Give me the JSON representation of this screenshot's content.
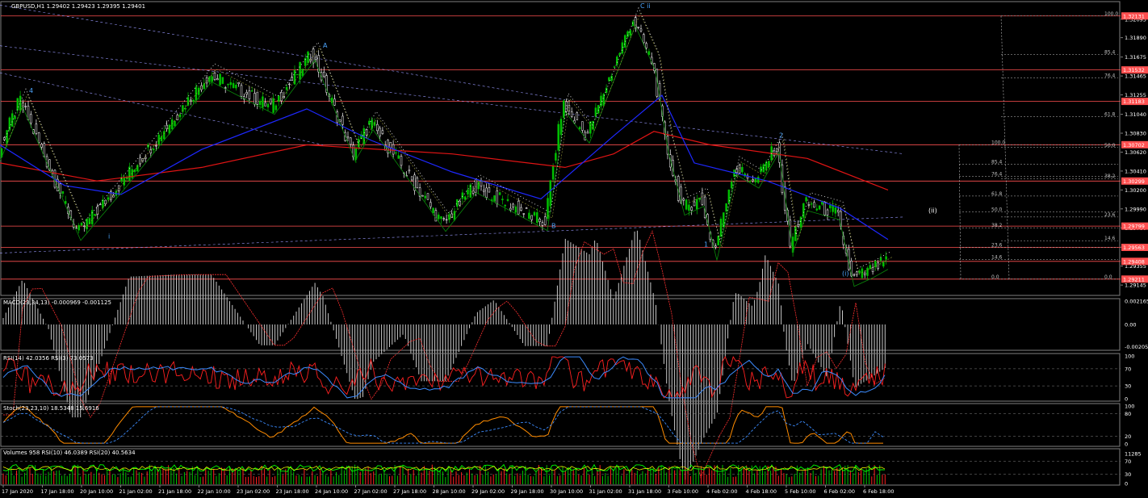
{
  "header": {
    "symbol_title": "GBPUSD,H1  1.29402 1.29423 1.29395 1.29401"
  },
  "colors": {
    "background": "#000000",
    "grid": "#808080",
    "bull": "#00c000",
    "bear": "#ffffff",
    "hline": "#ff5050",
    "ma_long": "#e01414",
    "ma_mid": "#1e28ff",
    "price_badge": "#ff5050",
    "macd_hist": "#c8c8c8",
    "macd_signal": "#ff3030",
    "rsi_slow": "#3c8cff",
    "rsi_fast": "#ff2020",
    "stoch_main": "#ff8c00",
    "stoch_signal": "#3c8cff",
    "vol_bar": "#00c000",
    "vol_rsi10": "#00ff00",
    "vol_rsi20": "#ffff00",
    "wave_label": "#4da6ff",
    "fib": "#c0c0c0"
  },
  "chart_data": [
    {
      "type": "candlestick",
      "title": "GBPUSD,H1",
      "ohlc_last": {
        "open": 1.29402,
        "high": 1.29423,
        "low": 1.29395,
        "close": 1.29401
      },
      "ylim": [
        1.2903,
        1.3229
      ],
      "y_ticks": [
        "1.32095",
        "1.31890",
        "1.31675",
        "1.31465",
        "1.31255",
        "1.31040",
        "1.30830",
        "1.30620",
        "1.30410",
        "1.30200",
        "1.29990",
        "1.29780",
        "1.29565",
        "1.29355",
        "1.29145"
      ],
      "x_ticks": [
        "17 Jan 2020",
        "17 Jan 18:00",
        "20 Jan 10:00",
        "21 Jan 02:00",
        "21 Jan 18:00",
        "22 Jan 10:00",
        "23 Jan 02:00",
        "23 Jan 18:00",
        "24 Jan 10:00",
        "27 Jan 02:00",
        "27 Jan 18:00",
        "28 Jan 10:00",
        "29 Jan 02:00",
        "29 Jan 18:00",
        "30 Jan 10:00",
        "31 Jan 02:00",
        "31 Jan 18:00",
        "3 Feb 10:00",
        "4 Feb 02:00",
        "4 Feb 18:00",
        "5 Feb 10:00",
        "6 Feb 02:00",
        "6 Feb 18:00"
      ],
      "price_levels": [
        "1.32131",
        "1.31532",
        "1.31183",
        "1.30702",
        "1.30299",
        "1.29799",
        "1.29563",
        "1.29408",
        "1.29211"
      ],
      "current_price": "1.29408",
      "wave_labels": [
        "4",
        "A",
        "C ii",
        "i",
        "B",
        "1",
        "2",
        "(i)",
        "(ii)"
      ],
      "fib_top": [
        "100.0",
        "85.4",
        "76.4",
        "61.8",
        "50.0",
        "38.2",
        "23.6",
        "14.6",
        "0.0"
      ],
      "fib_bottom": [
        "100.0",
        "85.4",
        "76.4",
        "61.8",
        "50.0",
        "38.2",
        "23.6",
        "14.6",
        "0.0"
      ],
      "swing_points": [
        {
          "x": 0,
          "y": 1.306
        },
        {
          "x": 28,
          "y": 1.312
        },
        {
          "x": 100,
          "y": 1.2972
        },
        {
          "x": 155,
          "y": 1.303
        },
        {
          "x": 262,
          "y": 1.3148
        },
        {
          "x": 340,
          "y": 1.3112
        },
        {
          "x": 390,
          "y": 1.3172
        },
        {
          "x": 440,
          "y": 1.306
        },
        {
          "x": 462,
          "y": 1.3095
        },
        {
          "x": 552,
          "y": 1.2982
        },
        {
          "x": 590,
          "y": 1.3025
        },
        {
          "x": 678,
          "y": 1.2983
        },
        {
          "x": 700,
          "y": 1.3115
        },
        {
          "x": 730,
          "y": 1.308
        },
        {
          "x": 787,
          "y": 1.321
        },
        {
          "x": 812,
          "y": 1.316
        },
        {
          "x": 828,
          "y": 1.307
        },
        {
          "x": 848,
          "y": 1.3
        },
        {
          "x": 872,
          "y": 1.301
        },
        {
          "x": 888,
          "y": 1.295
        },
        {
          "x": 912,
          "y": 1.3045
        },
        {
          "x": 940,
          "y": 1.303
        },
        {
          "x": 965,
          "y": 1.307
        },
        {
          "x": 982,
          "y": 1.2958
        },
        {
          "x": 1000,
          "y": 1.3005
        },
        {
          "x": 1040,
          "y": 1.2995
        },
        {
          "x": 1058,
          "y": 1.2921
        },
        {
          "x": 1080,
          "y": 1.293
        },
        {
          "x": 1100,
          "y": 1.294
        }
      ],
      "ma_long_path": [
        {
          "x": 0,
          "y": 1.305
        },
        {
          "x": 120,
          "y": 1.303
        },
        {
          "x": 250,
          "y": 1.3045
        },
        {
          "x": 380,
          "y": 1.307
        },
        {
          "x": 560,
          "y": 1.306
        },
        {
          "x": 700,
          "y": 1.3045
        },
        {
          "x": 760,
          "y": 1.306
        },
        {
          "x": 810,
          "y": 1.3085
        },
        {
          "x": 880,
          "y": 1.307
        },
        {
          "x": 1000,
          "y": 1.3055
        },
        {
          "x": 1100,
          "y": 1.302
        }
      ],
      "ma_mid_path": [
        {
          "x": 0,
          "y": 1.307
        },
        {
          "x": 80,
          "y": 1.3025
        },
        {
          "x": 150,
          "y": 1.3015
        },
        {
          "x": 250,
          "y": 1.3065
        },
        {
          "x": 380,
          "y": 1.311
        },
        {
          "x": 460,
          "y": 1.3075
        },
        {
          "x": 560,
          "y": 1.304
        },
        {
          "x": 670,
          "y": 1.301
        },
        {
          "x": 760,
          "y": 1.308
        },
        {
          "x": 820,
          "y": 1.3125
        },
        {
          "x": 860,
          "y": 1.305
        },
        {
          "x": 950,
          "y": 1.303
        },
        {
          "x": 1040,
          "y": 1.3
        },
        {
          "x": 1100,
          "y": 1.2965
        }
      ]
    },
    {
      "type": "histogram",
      "title": "MACD(23,34,13) -0.000969 -0.001125",
      "ylim": [
        -0.0024,
        0.0024
      ],
      "y_ticks": [
        "0.002165",
        "0.00",
        "-0.002053"
      ]
    },
    {
      "type": "line",
      "title": "RSI(14) 42.0356  RSI(3) 73.0573",
      "ylim": [
        0,
        100
      ],
      "y_ticks": [
        "100",
        "70",
        "30",
        "0"
      ],
      "levels": [
        70,
        30
      ]
    },
    {
      "type": "line",
      "title": "Stoch(23,23,10) 18.5348 15.6916",
      "ylim": [
        0,
        100
      ],
      "y_ticks": [
        "100",
        "80",
        "20",
        "0"
      ],
      "levels": [
        80,
        20
      ]
    },
    {
      "type": "bar",
      "title": "Volumes 958  RSI(10) 46.0389  RSI(20) 40.5634",
      "y_ticks": [
        "11285",
        "70",
        "30",
        "0"
      ],
      "levels": [
        70,
        30
      ]
    }
  ]
}
